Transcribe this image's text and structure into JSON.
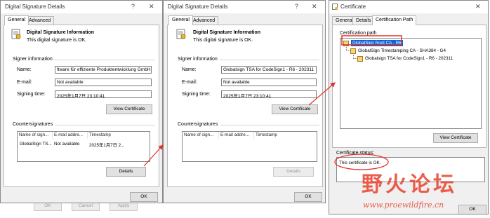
{
  "dialog1": {
    "title": "Digital Signature Details",
    "help": "?",
    "close": "✕",
    "tabs": [
      "General",
      "Advanced"
    ],
    "info_title": "Digital Signature Information",
    "info_status": "This digital signature is OK.",
    "signer_section": "Signer information",
    "name_label": "Name:",
    "name_value": "ftware für effiziente Produktentwicklung GmbH",
    "email_label": "E-mail:",
    "email_value": "Not available",
    "time_label": "Signing time:",
    "time_value": "2025年1月7日 23:10:41",
    "view_cert": "View Certificate",
    "counter_section": "Countersignatures",
    "cols": [
      "Name of sign...",
      "E-mail addre...",
      "Timestamp"
    ],
    "row": [
      "GlobalSign TS...",
      "Not available",
      "2025年1月7日 2..."
    ],
    "details": "Details",
    "ok": "OK",
    "behind_buttons": [
      "OK",
      "Cancel",
      "Apply"
    ]
  },
  "dialog2": {
    "title": "Digital Signature Details",
    "help": "?",
    "close": "✕",
    "tabs": [
      "General",
      "Advanced"
    ],
    "info_title": "Digital Signature Information",
    "info_status": "This digital signature is OK.",
    "signer_section": "Signer information",
    "name_label": "Name:",
    "name_value": "Globalsign TSA for CodeSign1 - R6 - 202311",
    "email_label": "E-mail:",
    "email_value": "Not available",
    "time_label": "Signing time:",
    "time_value": "2025年1月7日 23:10:41",
    "view_cert": "View Certificate",
    "counter_section": "Countersignatures",
    "cols": [
      "Name of sign...",
      "E-mail addre...",
      "Timestamp"
    ],
    "details": "Details",
    "ok": "OK"
  },
  "dialog3": {
    "title": "Certificate",
    "close": "✕",
    "tabs": [
      "General",
      "Details",
      "Certification Path"
    ],
    "path_label": "Certification path",
    "tree": [
      "GlobalSign Root CA - R6",
      "GlobalSign Timestamping CA - SHA384 - G4",
      "Globalsign TSA for CodeSign1 - R6 - 202311"
    ],
    "view_cert": "View Certificate",
    "status_label": "Certificate status:",
    "status_value": "This certificate is OK.",
    "ok": "OK"
  },
  "watermark": {
    "chinese": "野火论坛",
    "url": "www.proewildfire.cn"
  },
  "colors": {
    "annotation_red": "#e0302a",
    "selection_blue": "#0a64d8",
    "watermark_red": "#e8432d"
  }
}
